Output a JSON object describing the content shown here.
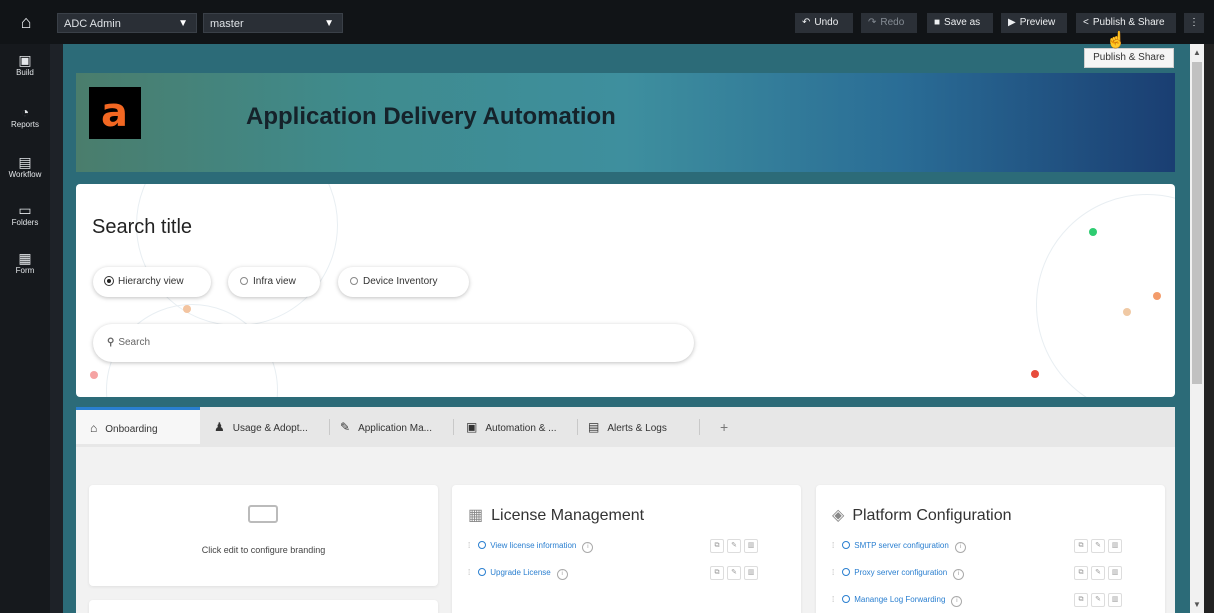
{
  "topbar": {
    "home_icon": "home-icon",
    "app_dropdown": "ADC Admin",
    "branch_dropdown": "master",
    "undo": "Undo",
    "redo": "Redo",
    "save_as": "Save as",
    "preview": "Preview",
    "publish_share": "Publish & Share",
    "tooltip": "Publish & Share"
  },
  "leftrail": {
    "items": [
      {
        "label": "Build",
        "icon": "build-icon"
      },
      {
        "label": "Reports",
        "icon": "reports-icon"
      },
      {
        "label": "Workflow",
        "icon": "workflow-icon"
      },
      {
        "label": "Folders",
        "icon": "folders-icon"
      },
      {
        "label": "Form",
        "icon": "form-icon"
      }
    ]
  },
  "banner": {
    "logo_letter": "a",
    "title": "Application Delivery Automation",
    "logo_color": "#f26722"
  },
  "search": {
    "title": "Search title",
    "views": [
      {
        "label": "Hierarchy view",
        "selected": true
      },
      {
        "label": "Infra view",
        "selected": false
      },
      {
        "label": "Device Inventory",
        "selected": false
      }
    ],
    "placeholder": "Search"
  },
  "tabs": [
    {
      "label": "Onboarding",
      "icon": "home-outline-icon",
      "active": true
    },
    {
      "label": "Usage & Adopt...",
      "icon": "users-icon",
      "active": false
    },
    {
      "label": "Application Ma...",
      "icon": "edit-icon",
      "active": false
    },
    {
      "label": "Automation & ...",
      "icon": "automation-icon",
      "active": false
    },
    {
      "label": "Alerts & Logs",
      "icon": "alerts-icon",
      "active": false
    }
  ],
  "add_tab": "+",
  "cards": {
    "branding": {
      "text": "Click edit to configure branding"
    },
    "license": {
      "title": "License Management",
      "items": [
        "View license information",
        "Upgrade License"
      ]
    },
    "platform": {
      "title": "Platform Configuration",
      "items": [
        "SMTP server configuration",
        "Proxy server configuration",
        "Manange Log Forwarding"
      ]
    }
  },
  "colors": {
    "accent": "#2a7fd0",
    "canvas": "#2c6b78",
    "topbar": "#111417"
  }
}
